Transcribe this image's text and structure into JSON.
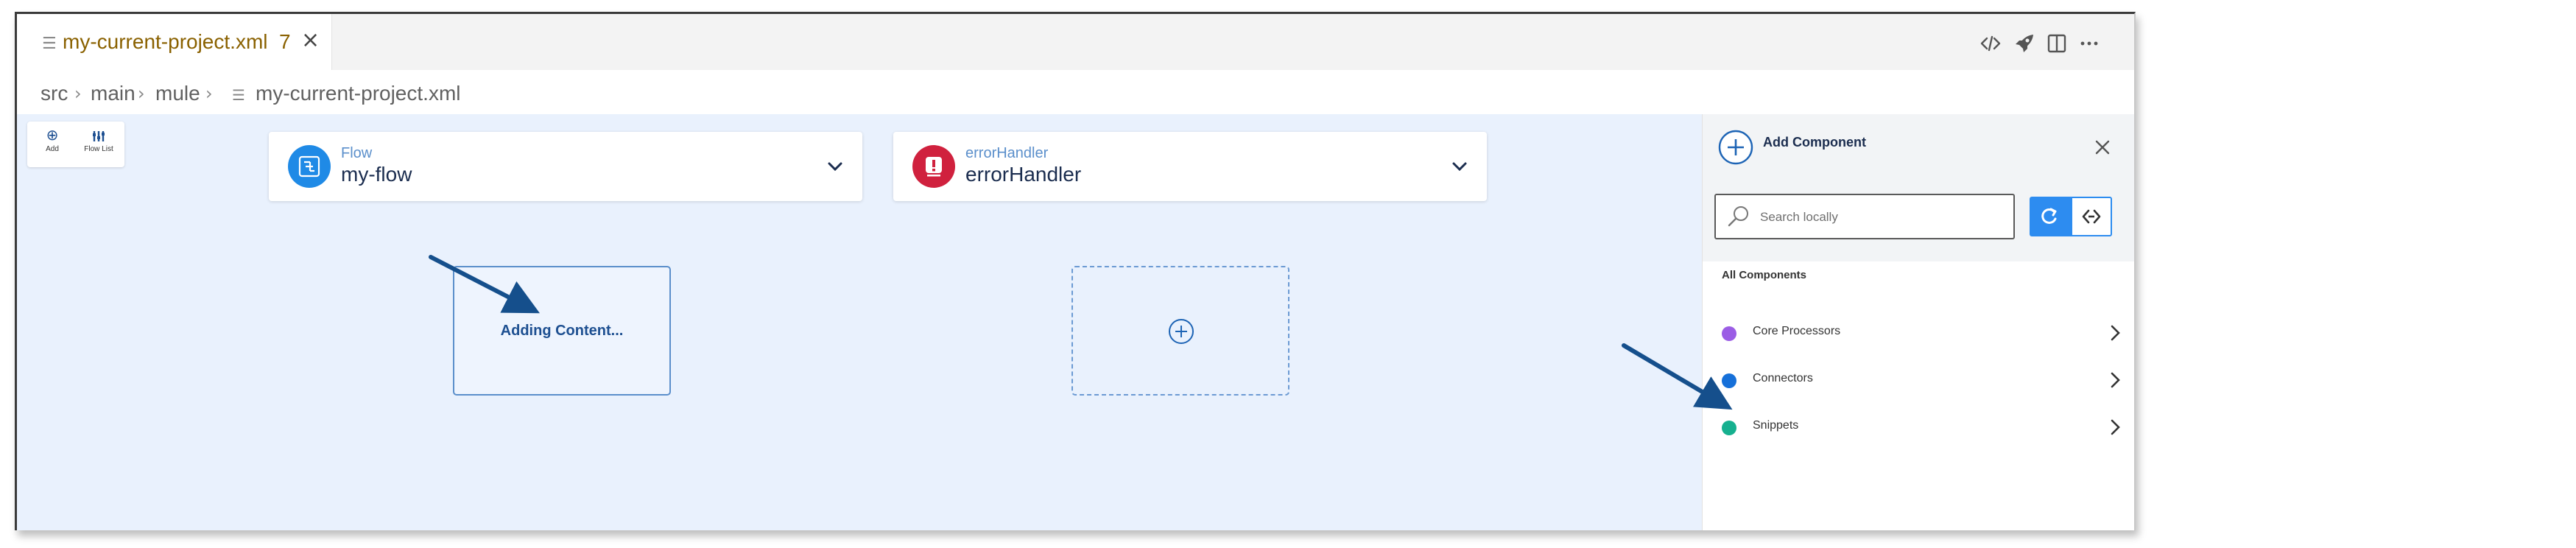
{
  "editor_tab": {
    "file_icon": "file-lines-icon",
    "label": "my-current-project.xml",
    "problem_count": "7",
    "close_icon": "×"
  },
  "title_actions": [
    "code-icon",
    "rocket-icon",
    "split-editor-icon",
    "more-icon"
  ],
  "breadcrumb": [
    "src",
    "main",
    "mule",
    "my-current-project.xml"
  ],
  "toolbox": {
    "add_label": "Add",
    "flow_list_label": "Flow List"
  },
  "flows": [
    {
      "type": "Flow",
      "name": "my-flow",
      "badge_color": "#1f8ae6",
      "type_color": "#5b8fcb"
    },
    {
      "type": "errorHandler",
      "name": "errorHandler",
      "badge_color": "#d0213e",
      "type_color": "#5b8fcb"
    }
  ],
  "canvas": {
    "adding_text": "Adding Content..."
  },
  "panel": {
    "title": "Add Component",
    "search_placeholder": "Search locally",
    "section_title": "All Components",
    "categories": [
      {
        "label": "Core Processors",
        "color": "#9b5de5"
      },
      {
        "label": "Connectors",
        "color": "#1670d9"
      },
      {
        "label": "Snippets",
        "color": "#16b08f"
      }
    ]
  },
  "colors": {
    "accent": "#1d4f91",
    "canvas_bg": "#e9f1fd",
    "toggle_active": "#2d8cf0",
    "annotation_arrow": "#154f8c"
  }
}
